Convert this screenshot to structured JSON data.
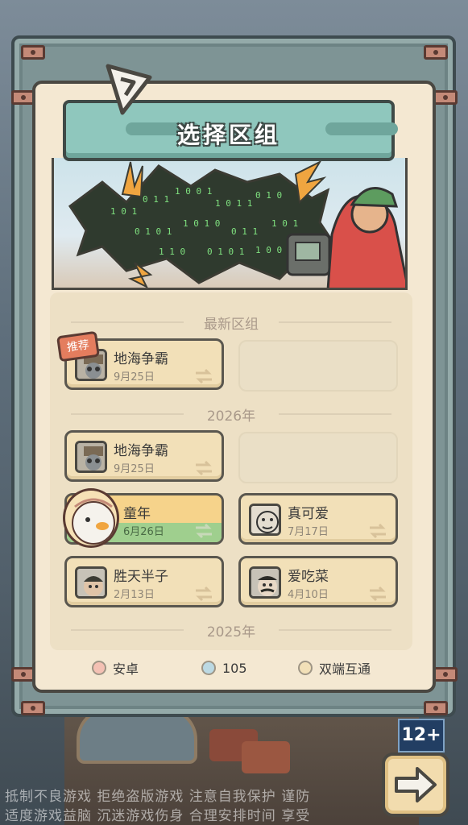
{
  "title": "选择区组",
  "sections": {
    "latest": "最新区组",
    "year_2026": "2026年",
    "year_2025": "2025年"
  },
  "badge_recommend": "推荐",
  "latest_servers": [
    {
      "name": "地海争霸",
      "date": "9月25日",
      "avatar": "gasmask-avatar"
    }
  ],
  "servers_2026": [
    {
      "name": "地海争霸",
      "date": "9月25日",
      "avatar": "gasmask-avatar"
    },
    {
      "name": "童年",
      "date": "6月26日",
      "avatar": "goose-avatar",
      "selected": true
    },
    {
      "name": "真可爱",
      "date": "7月17日",
      "avatar": "doodle-face-avatar"
    },
    {
      "name": "胜天半子",
      "date": "2月13日",
      "avatar": "man-avatar"
    },
    {
      "name": "爱吃菜",
      "date": "4月10日",
      "avatar": "mustache-avatar"
    }
  ],
  "legend": [
    {
      "label": "安卓",
      "color": "#f4c1b4"
    },
    {
      "label": "105",
      "color": "#bcd9e3"
    },
    {
      "label": "双端互通",
      "color": "#f2e0b8"
    }
  ],
  "age_rating": "12+",
  "notice_lines": [
    "抵制不良游戏  拒绝盗版游戏  注意自我保护  谨防",
    "适度游戏益脑  沉迷游戏伤身  合理安排时间  享受"
  ]
}
